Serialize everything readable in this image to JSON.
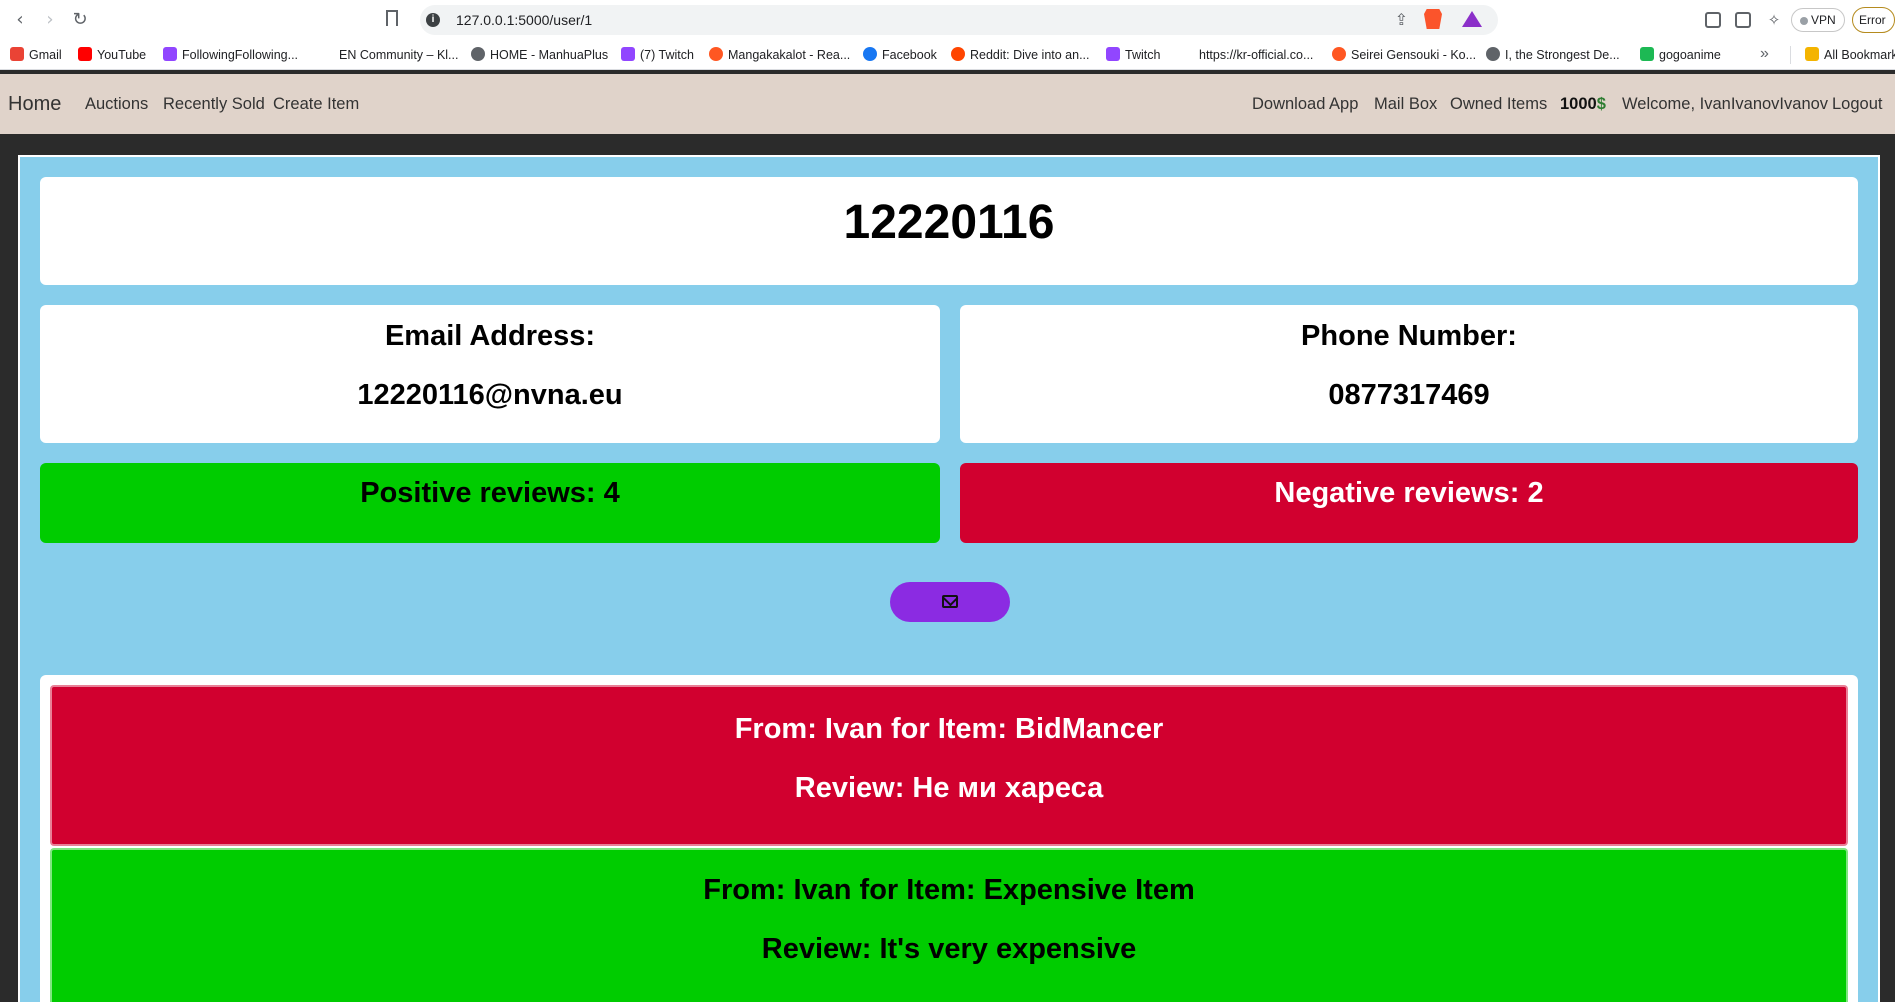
{
  "browser": {
    "url": "127.0.0.1:5000/user/1",
    "vpn_label": "VPN",
    "error_label": "Error",
    "bookmarks": [
      {
        "label": "Gmail",
        "color": "#ea4335"
      },
      {
        "label": "YouTube",
        "color": "#ff0000"
      },
      {
        "label": "FollowingFollowing...",
        "color": "#9146ff"
      },
      {
        "label": "EN Community – Kl...",
        "color": "#ffffff"
      },
      {
        "label": "HOME - ManhuaPlus",
        "color": "#5f6368"
      },
      {
        "label": "(7) Twitch",
        "color": "#9146ff"
      },
      {
        "label": "Mangakakalot - Rea...",
        "color": "#ff5722"
      },
      {
        "label": "Facebook",
        "color": "#1877f2"
      },
      {
        "label": "Reddit: Dive into an...",
        "color": "#ff4500"
      },
      {
        "label": "Twitch",
        "color": "#9146ff"
      },
      {
        "label": "https://kr-official.co...",
        "color": "#ffffff"
      },
      {
        "label": "Seirei Gensouki - Ko...",
        "color": "#ff5722"
      },
      {
        "label": "I, the Strongest De...",
        "color": "#5f6368"
      },
      {
        "label": "gogoanime",
        "color": "#1db954"
      }
    ],
    "all_bookmarks": "All Bookmarks"
  },
  "navbar": {
    "brand": "Home",
    "left_links": [
      "Auctions",
      "Recently Sold",
      "Create Item"
    ],
    "right_links": [
      "Download App",
      "Mail Box",
      "Owned Items"
    ],
    "balance_amount": "1000",
    "balance_currency": "$",
    "welcome": "Welcome, IvanIvanovIvanov",
    "logout": "Logout"
  },
  "user": {
    "username": "12220116",
    "email_label": "Email Address:",
    "email": "12220116@nvna.eu",
    "phone_label": "Phone Number:",
    "phone": "0877317469",
    "positive_reviews": "Positive reviews: 4",
    "negative_reviews": "Negative reviews: 2"
  },
  "reviews": [
    {
      "from": "From: Ivan for Item: BidMancer",
      "text": "Review: Не ми хареса",
      "sentiment": "negative"
    },
    {
      "from": "From: Ivan for Item: Expensive Item",
      "text": "Review: It's very expensive",
      "sentiment": "positive"
    }
  ],
  "colors": {
    "positive": "#00cc00",
    "negative": "#d1002f",
    "page_bg": "#87ceeb",
    "navbar_bg": "#e0d3ca",
    "mail_button": "#8b2be2"
  }
}
